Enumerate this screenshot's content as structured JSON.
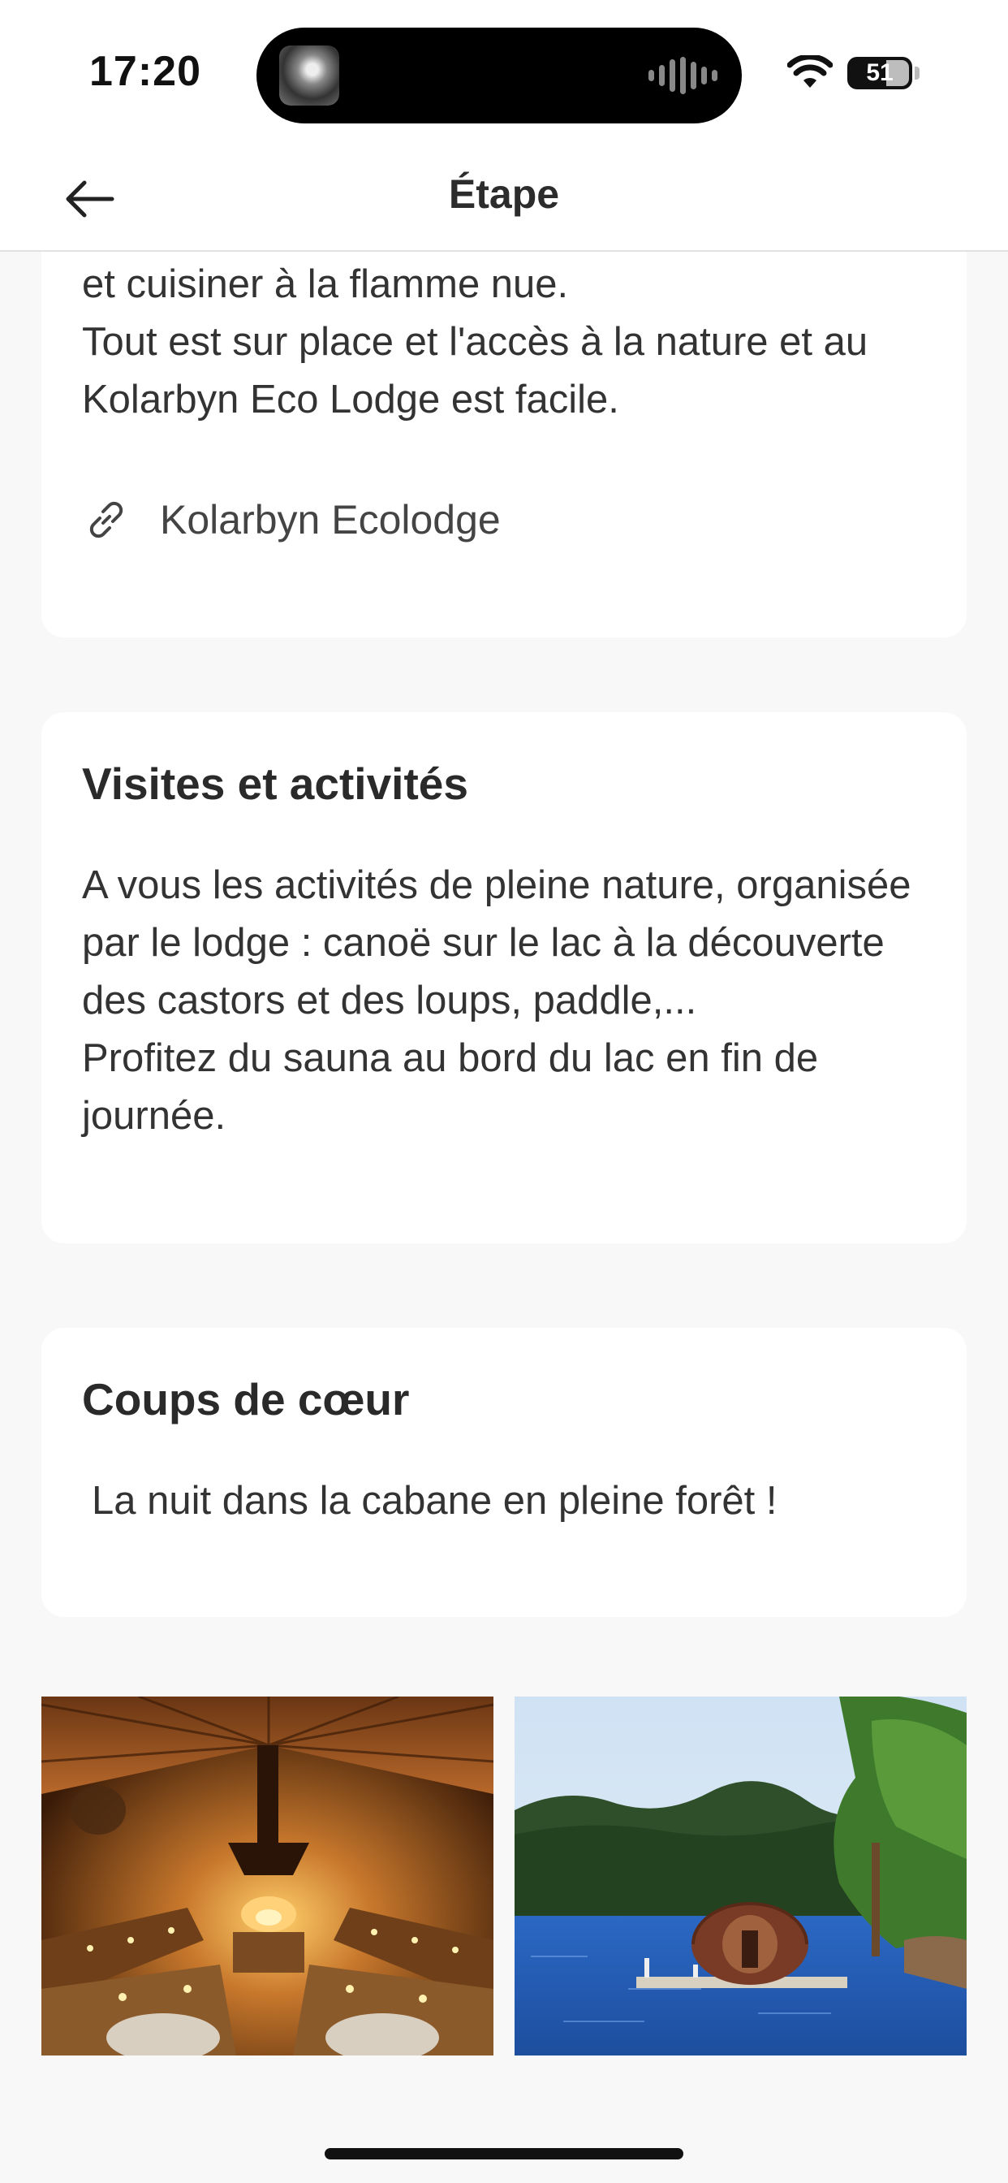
{
  "status_bar": {
    "time": "17:20",
    "battery": "51",
    "icons": [
      "wifi-icon",
      "battery-icon",
      "audio-waveform-icon"
    ]
  },
  "nav": {
    "title": "Étape",
    "back_icon": "arrow-left-icon"
  },
  "sections": {
    "hebergement": {
      "text": "et cuisiner à la flamme nue.\nTout est sur place et l'accès à la nature et au Kolarbyn Eco Lodge est facile.",
      "link_label": "Kolarbyn Ecolodge",
      "link_icon": "link-icon"
    },
    "visites": {
      "title": "Visites et activités",
      "text": "A vous les activités de pleine nature, organisée par le lodge : canoë sur le lac à la découverte des castors et des loups, paddle,...\nProfitez du sauna au bord du lac en fin de journée."
    },
    "coups_de_coeur": {
      "title": "Coups de cœur",
      "text": "La nuit dans la cabane en pleine forêt !"
    }
  },
  "gallery": {
    "photos": [
      "lodge-interior-photo",
      "lake-sauna-photo"
    ]
  },
  "colors": {
    "background": "#f8f8f8",
    "card": "#ffffff",
    "text": "#333333"
  }
}
